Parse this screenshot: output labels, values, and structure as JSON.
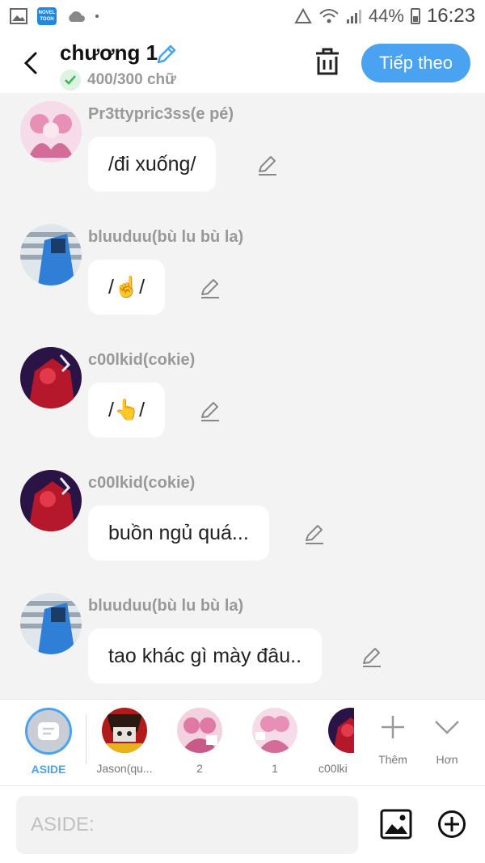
{
  "status_bar": {
    "app_badge": "NOVEL TOON",
    "battery": "44%",
    "time": "16:23"
  },
  "header": {
    "title": "chương 1",
    "word_count": "400/300 chữ",
    "next_label": "Tiếp theo"
  },
  "messages": [
    {
      "sender": "Pr3ttypric3ss(e pé)",
      "text": "/đi xuống/"
    },
    {
      "sender": "bluuduu(bù lu bù la)",
      "text": "/☝️/"
    },
    {
      "sender": "c00lkid(cokie)",
      "text": "/👆/"
    },
    {
      "sender": "c00lkid(cokie)",
      "text": "buồn ngủ quá..."
    },
    {
      "sender": "bluuduu(bù lu bù la)",
      "text": "tao khác gì mày đâu.."
    }
  ],
  "characters": [
    {
      "label": "ASIDE"
    },
    {
      "label": "Jason(qu..."
    },
    {
      "label": "2"
    },
    {
      "label": "1"
    },
    {
      "label": "c00lki"
    }
  ],
  "actions": {
    "more_label": "Thêm",
    "collapse_label": "Hơn"
  },
  "input": {
    "placeholder": "ASIDE:"
  },
  "colors": {
    "accent": "#4aa3f0",
    "background": "#f3f3f3"
  }
}
